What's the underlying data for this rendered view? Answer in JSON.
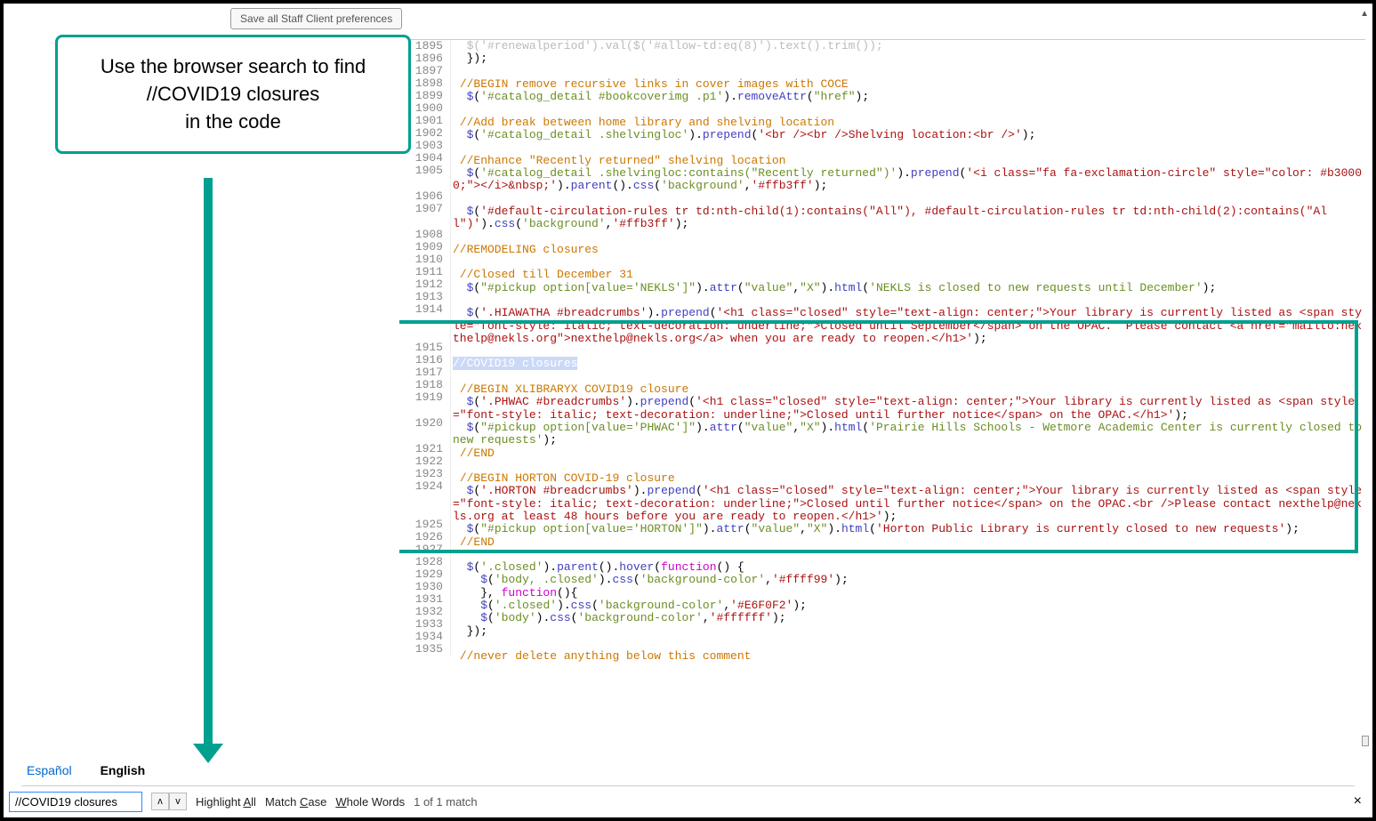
{
  "toolbar": {
    "save_label": "Save all Staff Client preferences"
  },
  "callout": {
    "line1": "Use the browser search to find",
    "line2": "//COVID19 closures",
    "line3": "in the code"
  },
  "tabs": {
    "es": "Español",
    "en": "English"
  },
  "find": {
    "value": "//COVID19 closures",
    "highlight": "Highlight All",
    "match": "Match Case",
    "whole": "Whole Words",
    "count": "1 of 1 match"
  },
  "first_line_no": 1895,
  "highlighted_text": "//COVID19 closures",
  "code_lines": [
    {
      "t": "  $('#renewalperiod').val($('#allow-td:eq(8)').text().trim());",
      "gray": true
    },
    {
      "t": "  });"
    },
    {
      "t": ""
    },
    {
      "t": " //BEGIN remove recursive links in cover images with COCE",
      "c": "or"
    },
    {
      "t": "  $('#catalog_detail #bookcoverimg .p1').removeAttr(\"href\");",
      "mix": "jq"
    },
    {
      "t": ""
    },
    {
      "t": " //Add break between home library and shelving location",
      "c": "or"
    },
    {
      "t": "  $('#catalog_detail .shelvingloc').prepend('<br /><br />Shelving location:<br />');",
      "mix": "jq2"
    },
    {
      "t": ""
    },
    {
      "t": " //Enhance \"Recently returned\" shelving location",
      "c": "or"
    },
    {
      "t": "  $('#catalog_detail .shelvingloc:contains(\"Recently returned\")').prepend('<i class=\"fa fa-exclamation-circle\" style=\"color: #b30000;\"></i>&nbsp;').parent().css('background','#ffb3ff');",
      "mix": "jq3"
    },
    {
      "t": ""
    },
    {
      "t": "  $('#default-circulation-rules tr td:nth-child(1):contains(\"All\"), #default-circulation-rules tr td:nth-child(2):contains(\"All\")').css('background','#ffb3ff');",
      "mix": "jq"
    },
    {
      "t": ""
    },
    {
      "t": "//REMODELING closures",
      "c": "or"
    },
    {
      "t": ""
    },
    {
      "t": " //Closed till December 31",
      "c": "or"
    },
    {
      "t": "  $(\"#pickup option[value='NEKLS']\").attr(\"value\",\"X\").html('NEKLS is closed to new requests until December');",
      "mix": "jq"
    },
    {
      "t": ""
    },
    {
      "t": "  $('.HIAWATHA #breadcrumbs').prepend('<h1 class=\"closed\" style=\"text-align: center;\">Your library is currently listed as <span style=\"font-style: italic; text-decoration: underline;\">Closed until September</span> on the OPAC.  Please contact <a href=\"mailto:nexthelp@nekls.org\">nexthelp@nekls.org</a> when you are ready to reopen.</h1>');",
      "mix": "jq3"
    },
    {
      "t": ""
    },
    {
      "t": "//COVID19 closures",
      "hl": true
    },
    {
      "t": ""
    },
    {
      "t": " //BEGIN XLIBRARYX COVID19 closure",
      "c": "or"
    },
    {
      "t": "  $('.PHWAC #breadcrumbs').prepend('<h1 class=\"closed\" style=\"text-align: center;\">Your library is currently listed as <span style=\"font-style: italic; text-decoration: underline;\">Closed until further notice</span> on the OPAC.</h1>');",
      "mix": "jq3"
    },
    {
      "t": "  $(\"#pickup option[value='PHWAC']\").attr(\"value\",\"X\").html('Prairie Hills Schools - Wetmore Academic Center is currently closed to new requests');",
      "mix": "jq"
    },
    {
      "t": " //END",
      "c": "or"
    },
    {
      "t": ""
    },
    {
      "t": " //BEGIN HORTON COVID-19 closure",
      "c": "or"
    },
    {
      "t": "  $('.HORTON #breadcrumbs').prepend('<h1 class=\"closed\" style=\"text-align: center;\">Your library is currently listed as <span style=\"font-style: italic; text-decoration: underline;\">Closed until further notice</span> on the OPAC.<br />Please contact nexthelp@nekls.org at least 48 hours before you are ready to reopen.</h1>');",
      "mix": "jq3"
    },
    {
      "t": "  $(\"#pickup option[value='HORTON']\").attr(\"value\",\"X\").html('Horton Public Library is currently closed to new requests');",
      "mix": "jq"
    },
    {
      "t": " //END",
      "c": "or"
    },
    {
      "t": ""
    },
    {
      "t": "  $('.closed').parent().hover(function() {",
      "mix": "jq4"
    },
    {
      "t": "    $('body, .closed').css('background-color','#ffff99');",
      "mix": "jq"
    },
    {
      "t": "    }, function(){",
      "mix": "jq4"
    },
    {
      "t": "    $('.closed').css('background-color','#E6F0F2');",
      "mix": "jq"
    },
    {
      "t": "    $('body').css('background-color','#ffffff');",
      "mix": "jq"
    },
    {
      "t": "  });"
    },
    {
      "t": ""
    },
    {
      "t": " //never delete anything below this comment",
      "c": "or"
    }
  ]
}
